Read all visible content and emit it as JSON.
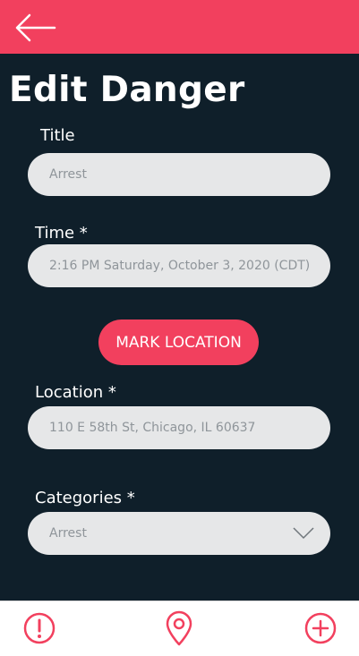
{
  "page_title": "Edit Danger",
  "form": {
    "title_label": "Title",
    "title_placeholder": "Arrest",
    "time_label": "Time *",
    "time_placeholder": "2:16 PM Saturday, October 3, 2020 (CDT)",
    "mark_location_label": "MARK LOCATION",
    "location_label": "Location *",
    "location_placeholder": "110 E 58th St, Chicago, IL 60637",
    "categories_label": "Categories *",
    "categories_value": "Arrest"
  },
  "icons": {
    "back": "arrow-left-icon",
    "report": "exclamation-circle-icon",
    "map": "map-pin-icon",
    "add": "plus-circle-icon"
  },
  "colors": {
    "accent": "#f2405e",
    "background": "#0f1f2a",
    "field": "#e6e7e8",
    "field_text": "#8f959a"
  }
}
